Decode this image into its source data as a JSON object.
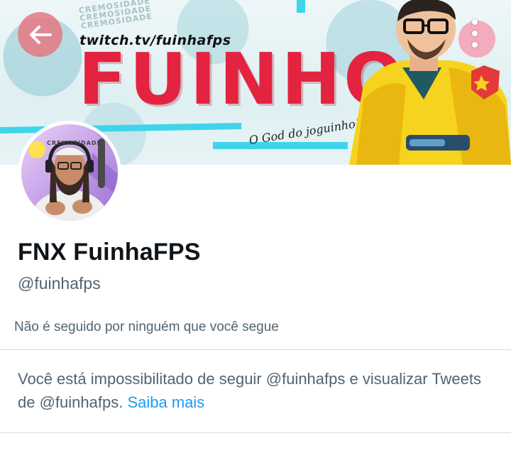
{
  "banner": {
    "twitch_url": "twitch.tv/fuinhafps",
    "brand_name": "FUINHO",
    "tagline": "O God do joguinho!",
    "watermark": "CREMOSIDADE CREMOSIDADE CREMOSIDADE",
    "colors": {
      "brand_red": "#e3233f",
      "accent_cyan": "#3fd4ea"
    }
  },
  "navigation": {
    "back_icon": "arrow-left-icon",
    "more_icon": "more-vertical-icon"
  },
  "avatar": {
    "watermark": "CREMOSIDADE"
  },
  "profile": {
    "display_name": "FNX FuinhaFPS",
    "handle": "@fuinhafps",
    "followers_you_know": "Não é seguido por ninguém que você segue"
  },
  "notice": {
    "message": "Você está impossibilitado de seguir @fuinhafps e visualizar Tweets de @fuinhafps.",
    "learn_more": "Saiba mais",
    "link_color": "#1d9bf0"
  }
}
